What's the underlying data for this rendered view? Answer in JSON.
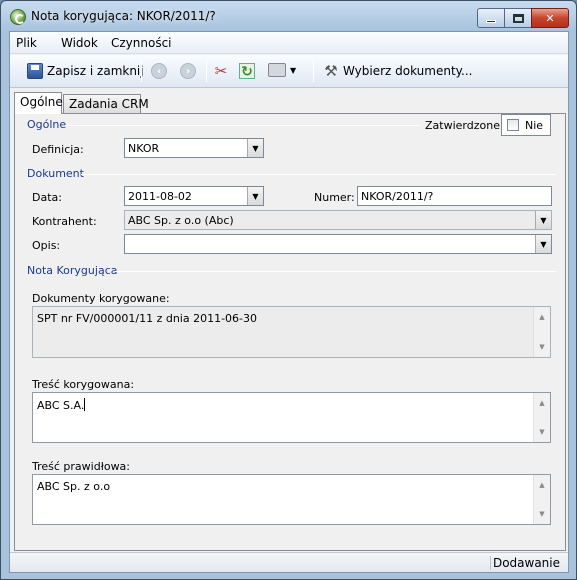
{
  "window": {
    "title": "Nota korygująca: NKOR/2011/?"
  },
  "menu": {
    "items": [
      "Plik",
      "Widok",
      "Czynności"
    ]
  },
  "toolbar": {
    "save_label": "Zapisz i zamknij",
    "choose_docs_label": "Wybierz dokumenty..."
  },
  "tabs": [
    {
      "label": "Ogólne",
      "active": true
    },
    {
      "label": "Zadania CRM",
      "active": false
    }
  ],
  "general": {
    "section_title": "Ogólne",
    "approved_label": "Zatwierdzone:",
    "approved_value": "Nie",
    "definition_label": "Definicja:",
    "definition_value": "NKOR"
  },
  "document": {
    "section_title": "Dokument",
    "date_label": "Data:",
    "date_value": "2011-08-02",
    "number_label": "Numer:",
    "number_value": "NKOR/2011/?",
    "contractor_label": "Kontrahent:",
    "contractor_value": "ABC Sp. z o.o (Abc)",
    "description_label": "Opis:",
    "description_value": ""
  },
  "correction": {
    "section_title": "Nota Korygująca",
    "corrected_docs_label": "Dokumenty korygowane:",
    "corrected_docs_value": "SPT nr FV/000001/11 z dnia 2011-06-30",
    "corrected_content_label": "Treść korygowana:",
    "corrected_content_value": "ABC S.A.",
    "correct_content_label": "Treść prawidłowa:",
    "correct_content_value": "ABC Sp. z o.o"
  },
  "status": {
    "mode": "Dodawanie"
  },
  "colors": {
    "section_text": "#1a3a8c",
    "frame": "#a9c3dd",
    "close_button": "#c6452d"
  }
}
